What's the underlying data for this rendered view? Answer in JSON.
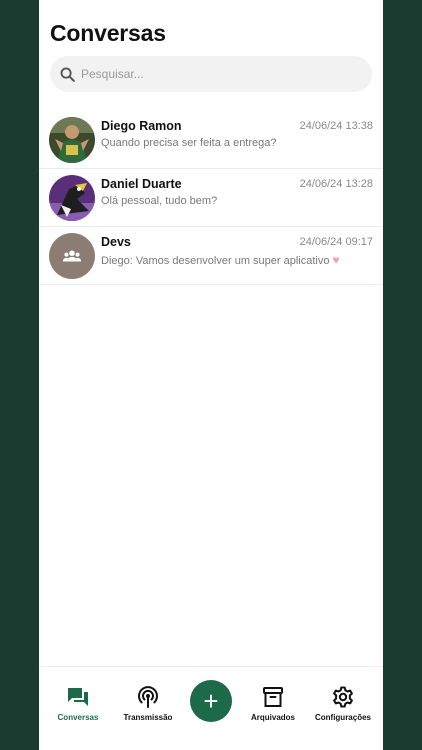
{
  "header": {
    "title": "Conversas"
  },
  "search": {
    "placeholder": "Pesquisar..."
  },
  "chats": [
    {
      "name": "Diego Ramon",
      "time": "24/06/24 13:38",
      "message": "Quando precisa ser feita a entrega?",
      "avatar": "photo-avatar"
    },
    {
      "name": "Daniel Duarte",
      "time": "24/06/24 13:28",
      "message": "Olá pessoal, tudo bem?",
      "avatar": "photo-avatar"
    },
    {
      "name": "Devs",
      "time": "24/06/24 09:17",
      "message": "Diego: Vamos desenvolver um super aplicativo",
      "emoji": "♥",
      "avatar": "group-icon"
    }
  ],
  "nav": {
    "items": [
      {
        "label": "Conversas",
        "icon": "chat-bubbles-icon",
        "active": true
      },
      {
        "label": "Transmissão",
        "icon": "broadcast-icon",
        "active": false
      },
      {
        "label": "Arquivados",
        "icon": "archive-icon",
        "active": false
      },
      {
        "label": "Configurações",
        "icon": "gear-icon",
        "active": false
      }
    ],
    "fab_label": "+"
  },
  "colors": {
    "background": "#1b3a30",
    "accent": "#1d6a4a",
    "group_avatar": "#8c7d74"
  }
}
